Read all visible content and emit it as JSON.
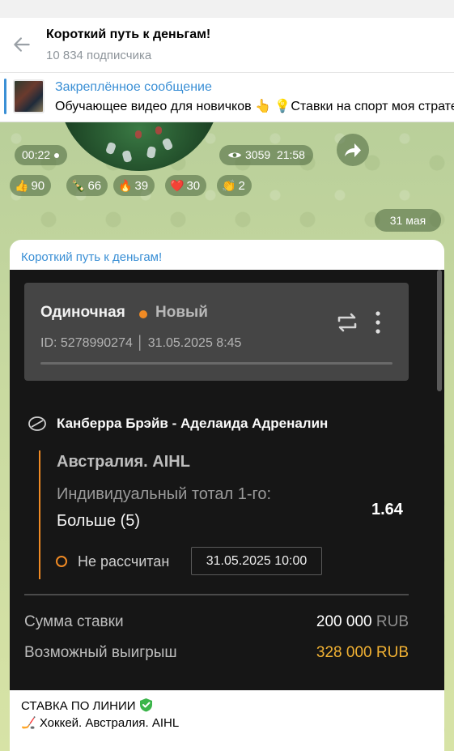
{
  "header": {
    "title": "Короткий путь к деньгам!",
    "subscribers": "10 834 подписчика"
  },
  "pinned": {
    "label": "Закреплённое сообщение",
    "text": "Обучающее видео для новичков 👆 💡Ставки на спорт моя стратегия"
  },
  "video_message": {
    "duration": "00:22",
    "views": "3059",
    "time": "21:58"
  },
  "reactions": [
    {
      "emoji": "👍",
      "count": "90"
    },
    {
      "emoji": "🍾",
      "count": "66"
    },
    {
      "emoji": "🔥",
      "count": "39"
    },
    {
      "emoji": "❤️",
      "count": "30"
    },
    {
      "emoji": "👏",
      "count": "2"
    }
  ],
  "date_divider": "31 мая",
  "post": {
    "author": "Короткий путь к деньгам!",
    "bet": {
      "type": "Одиночная",
      "status": "Новый",
      "id_line": "ID: 5278990274 │ 31.05.2025 8:45",
      "match": "Канберра Брэйв - Аделаида Адреналин",
      "league": "Австралия. AIHL",
      "market": "Индивидуальный тотал 1-го:",
      "outcome": "Больше (5)",
      "odds": "1.64",
      "settle_status": "Не рассчитан",
      "settle_time": "31.05.2025 10:00",
      "stake_label": "Сумма ставки",
      "stake_amount": "200 000",
      "stake_currency": "RUB",
      "win_label": "Возможный выигрыш",
      "win_amount": "328 000 RUB"
    },
    "caption_line1": "СТАВКА ПО ЛИНИИ",
    "caption_line2": "🏒 Хоккей. Австралия. AIHL"
  },
  "icons": {
    "back": "arrow-left-icon",
    "share": "share-arrow-icon",
    "views": "eye-icon",
    "repeat": "repeat-icon",
    "more": "kebab-menu-icon",
    "sport": "hockey-puck-icon",
    "verified": "shield-check-icon"
  },
  "colors": {
    "accent": "#3a8fd5",
    "bet_orange": "#f08a24",
    "win_gold": "#f2b233",
    "verified_green": "#3bb54a"
  }
}
